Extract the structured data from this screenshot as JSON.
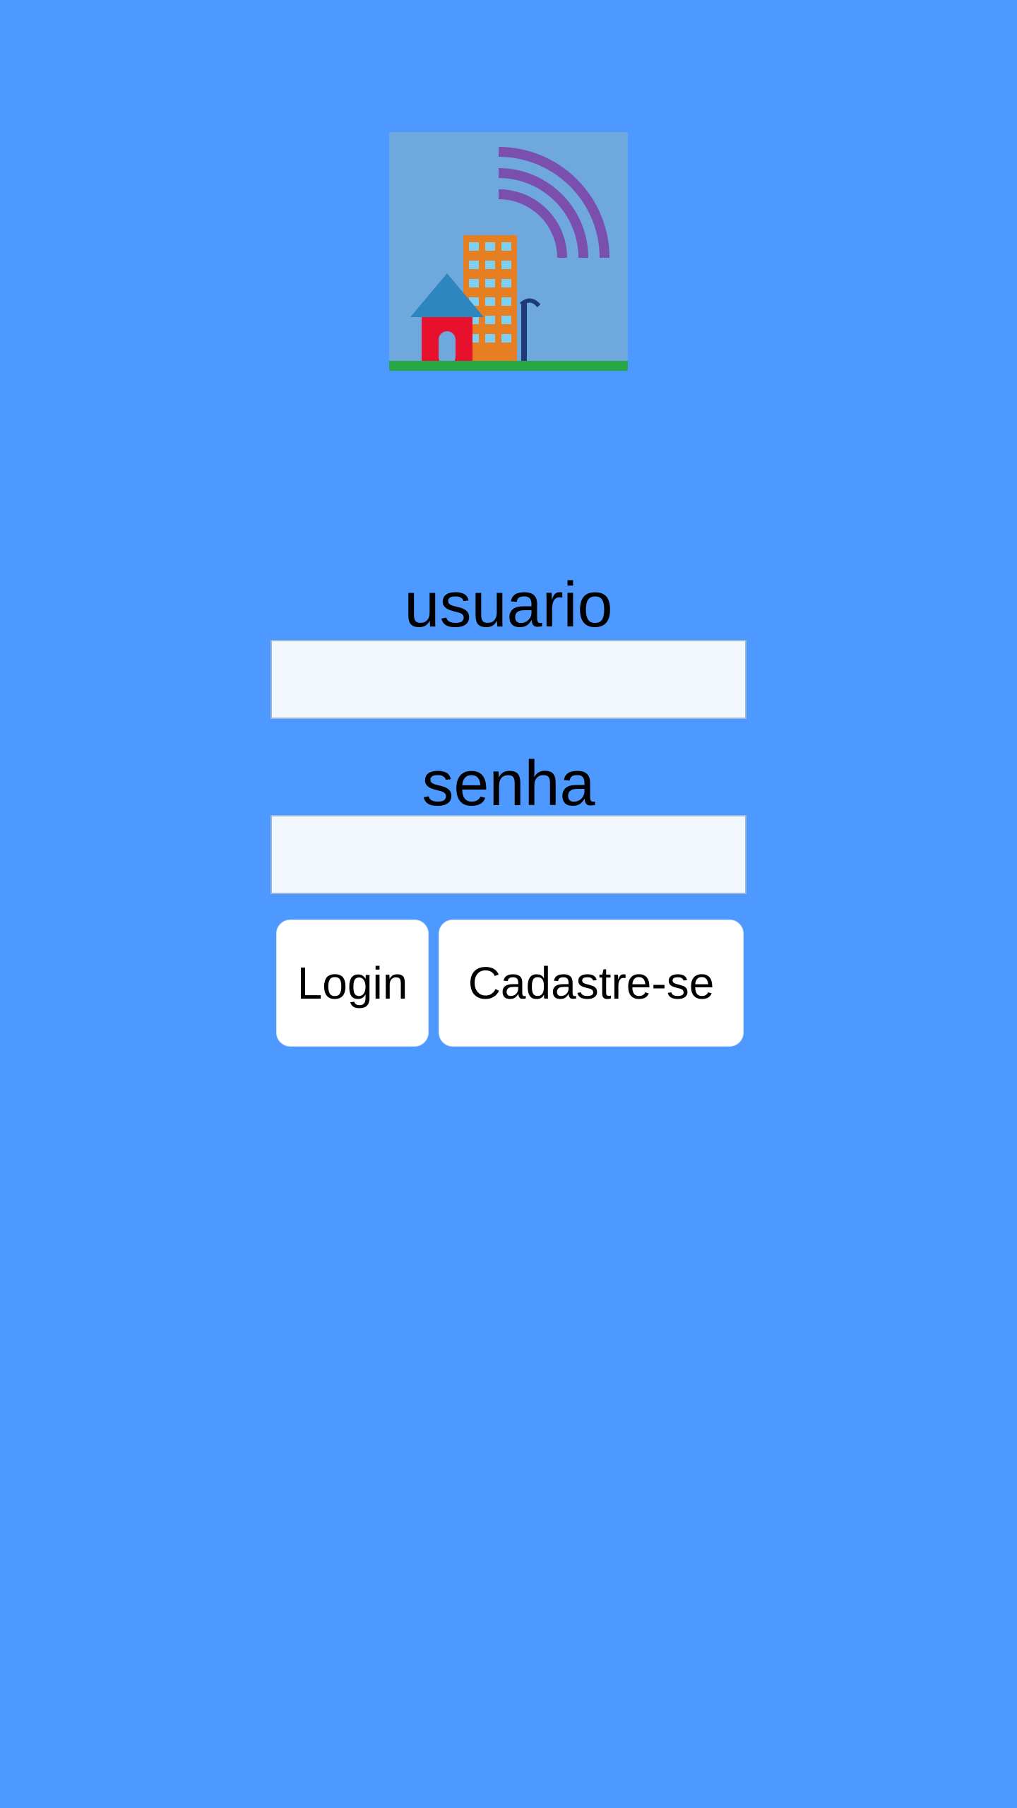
{
  "logo": {
    "icon": "house-building-antenna-logo",
    "background_color": "#6fa8dc"
  },
  "form": {
    "username_label": "usuario",
    "username_value": "",
    "password_label": "senha",
    "password_value": ""
  },
  "buttons": {
    "login_label": "Login",
    "register_label": "Cadastre-se"
  },
  "colors": {
    "background": "#4d99ff",
    "input_background": "#f3f8fe",
    "button_background": "#ffffff"
  }
}
